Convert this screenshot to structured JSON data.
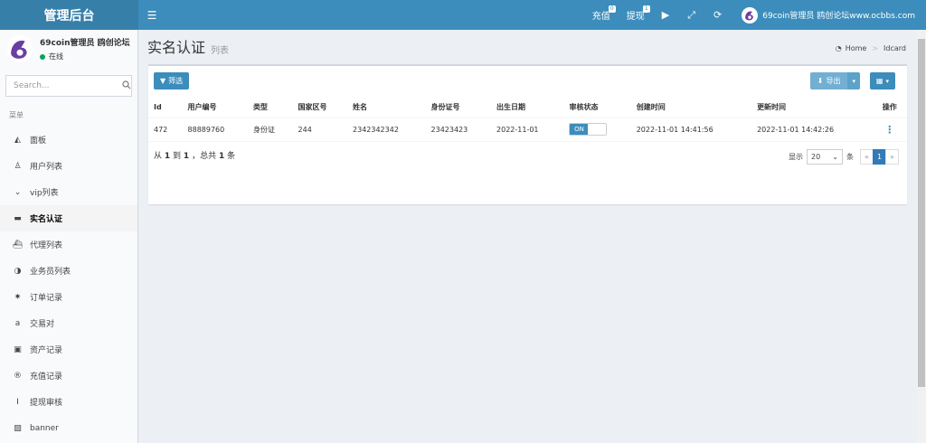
{
  "brand": {
    "title": "管理后台"
  },
  "topbar": {
    "recharge_label": "充值",
    "recharge_badge": "0",
    "withdraw_label": "提现",
    "withdraw_badge": "1",
    "user_name": "69coin管理员 鸥创论坛www.ocbbs.com"
  },
  "sidebar": {
    "user_name": "69coin管理员 鸥创论坛www.ocbbs.com",
    "status": "在线",
    "search_placeholder": "Search...",
    "menu_header": "菜单",
    "items": [
      {
        "icon": "area-chart-icon",
        "label": "面板"
      },
      {
        "icon": "user-icon",
        "label": "用户列表"
      },
      {
        "icon": "chevron-circle-icon",
        "label": "vip列表"
      },
      {
        "icon": "credit-card-icon",
        "label": "实名认证"
      },
      {
        "icon": "ship-icon",
        "label": "代理列表"
      },
      {
        "icon": "adjust-icon",
        "label": "业务员列表"
      },
      {
        "icon": "gear-icon",
        "label": "订单记录"
      },
      {
        "icon": "amazon-icon",
        "label": "交易对"
      },
      {
        "icon": "money-icon",
        "label": "资产记录"
      },
      {
        "icon": "registered-icon",
        "label": "充值记录"
      },
      {
        "icon": "text-height-icon",
        "label": "提现审核"
      },
      {
        "icon": "image-icon",
        "label": "banner"
      }
    ],
    "active_index": 3
  },
  "header": {
    "title": "实名认证",
    "subtitle": "列表",
    "breadcrumb_home": "Home",
    "breadcrumb_current": "Idcard"
  },
  "toolbar": {
    "filter_label": "筛选",
    "export_label": "导出"
  },
  "table": {
    "columns": [
      "Id",
      "用户编号",
      "类型",
      "国家区号",
      "姓名",
      "身份证号",
      "出生日期",
      "审核状态",
      "创建时间",
      "更新时间",
      "操作"
    ],
    "rows": [
      {
        "id": "472",
        "user_no": "88889760",
        "type": "身份证",
        "country_code": "244",
        "name": "2342342342",
        "id_number": "23423423",
        "birth": "2022-11-01",
        "status": "ON",
        "created": "2022-11-01 14:41:56",
        "updated": "2022-11-01 14:42:26"
      }
    ]
  },
  "footer": {
    "from_label": "从",
    "from": "1",
    "to_label": "到",
    "to": "1",
    "total_label": "，总共",
    "total": "1",
    "unit": "条",
    "show_label": "显示",
    "page_size": "20",
    "page_size_unit": "条",
    "prev": "«",
    "current_page": "1",
    "next": "»"
  },
  "colors": {
    "topbar": "#3c8dbc",
    "brand": "#367fa9",
    "status_online": "#00a65a"
  }
}
